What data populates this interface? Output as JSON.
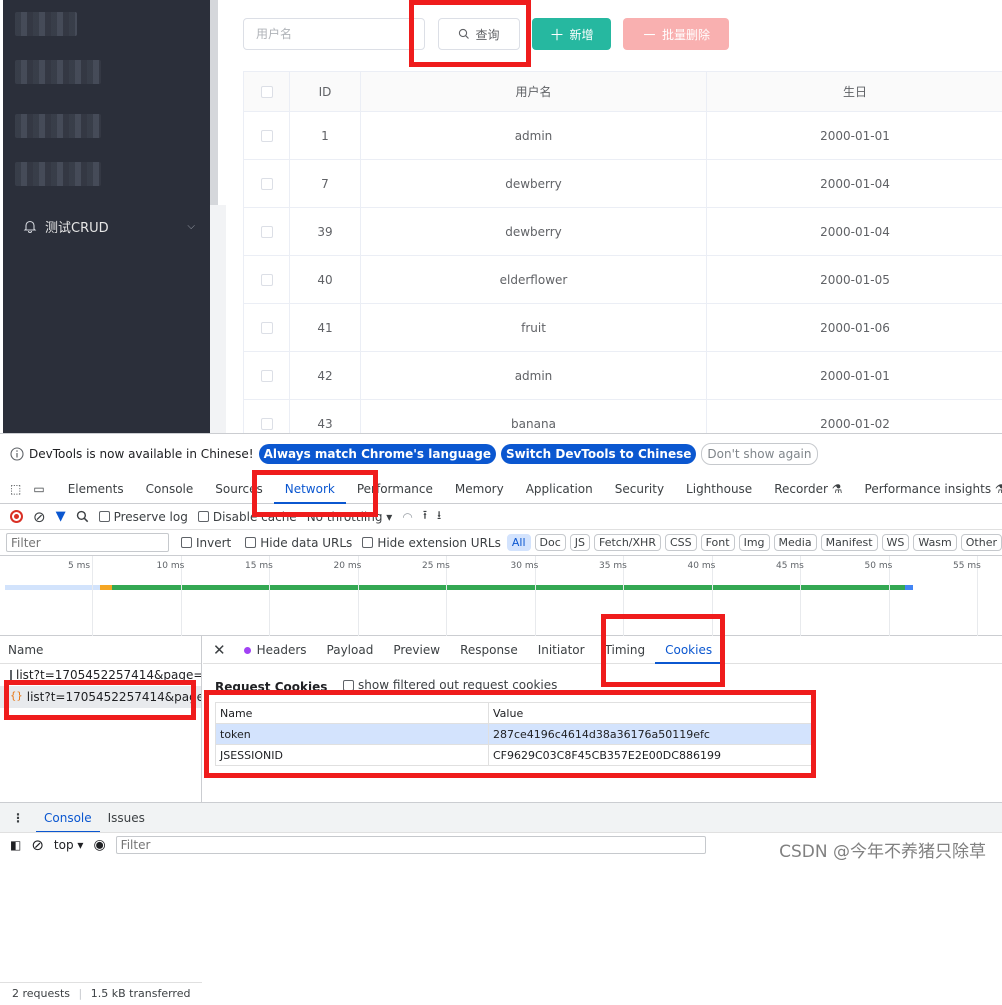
{
  "app": {
    "sidebar_menu_label": "测试CRUD",
    "search_placeholder": "用户名",
    "query_label": "查询",
    "add_label": "新增",
    "bulk_delete_label": "批量删除",
    "columns": [
      "ID",
      "用户名",
      "生日"
    ],
    "rows": [
      {
        "id": "1",
        "username": "admin",
        "birthday": "2000-01-01"
      },
      {
        "id": "7",
        "username": "dewberry",
        "birthday": "2000-01-04"
      },
      {
        "id": "39",
        "username": "dewberry",
        "birthday": "2000-01-04"
      },
      {
        "id": "40",
        "username": "elderflower",
        "birthday": "2000-01-05"
      },
      {
        "id": "41",
        "username": "fruit",
        "birthday": "2000-01-06"
      },
      {
        "id": "42",
        "username": "admin",
        "birthday": "2000-01-01"
      },
      {
        "id": "43",
        "username": "banana",
        "birthday": "2000-01-02"
      }
    ]
  },
  "devtools": {
    "lang_notice": "DevTools is now available in Chinese!",
    "lang_btn_match": "Always match Chrome's language",
    "lang_btn_switch": "Switch DevTools to Chinese",
    "lang_btn_dismiss": "Don't show again",
    "tabs": [
      "Elements",
      "Console",
      "Sources",
      "Network",
      "Performance",
      "Memory",
      "Application",
      "Security",
      "Lighthouse",
      "Recorder ⚗",
      "Performance insights ⚗"
    ],
    "active_tab": "Network",
    "toolbar": {
      "preserve_log": "Preserve log",
      "disable_cache": "Disable cache",
      "throttling": "No throttling"
    },
    "filter": {
      "placeholder": "Filter",
      "invert": "Invert",
      "hide_data_urls": "Hide data URLs",
      "hide_extension_urls": "Hide extension URLs",
      "types": [
        "All",
        "Doc",
        "JS",
        "Fetch/XHR",
        "CSS",
        "Font",
        "Img",
        "Media",
        "Manifest",
        "WS",
        "Wasm",
        "Other"
      ]
    },
    "timeline_ticks": [
      "5 ms",
      "10 ms",
      "15 ms",
      "20 ms",
      "25 ms",
      "30 ms",
      "35 ms",
      "40 ms",
      "45 ms",
      "50 ms",
      "55 ms"
    ],
    "requests": {
      "header": "Name",
      "items": [
        "list?t=1705452257414&page=...",
        "list?t=1705452257414&page=..."
      ],
      "summary_count": "2 requests",
      "summary_size": "1.5 kB transferred"
    },
    "detail_tabs": [
      "Headers",
      "Payload",
      "Preview",
      "Response",
      "Initiator",
      "Timing",
      "Cookies"
    ],
    "active_detail_tab": "Cookies",
    "cookies": {
      "title": "Request Cookies",
      "show_filtered": "show filtered out request cookies",
      "columns": [
        "Name",
        "Value"
      ],
      "rows": [
        {
          "name": "token",
          "value": "287ce4196c4614d38a36176a50119efc"
        },
        {
          "name": "JSESSIONID",
          "value": "CF9629C03C8F45CB357E2E00DC886199"
        }
      ]
    },
    "drawer_tabs": [
      "Console",
      "Issues"
    ],
    "console_context": "top",
    "console_filter_placeholder": "Filter"
  },
  "watermark": "CSDN @今年不养猪只除草",
  "colors": {
    "highlight": "#ef1c1c",
    "accent": "#0b57d0",
    "add_button": "#26b8a0",
    "bulk_delete": "#f9b0b0",
    "sidebar": "#2b2f3a"
  }
}
